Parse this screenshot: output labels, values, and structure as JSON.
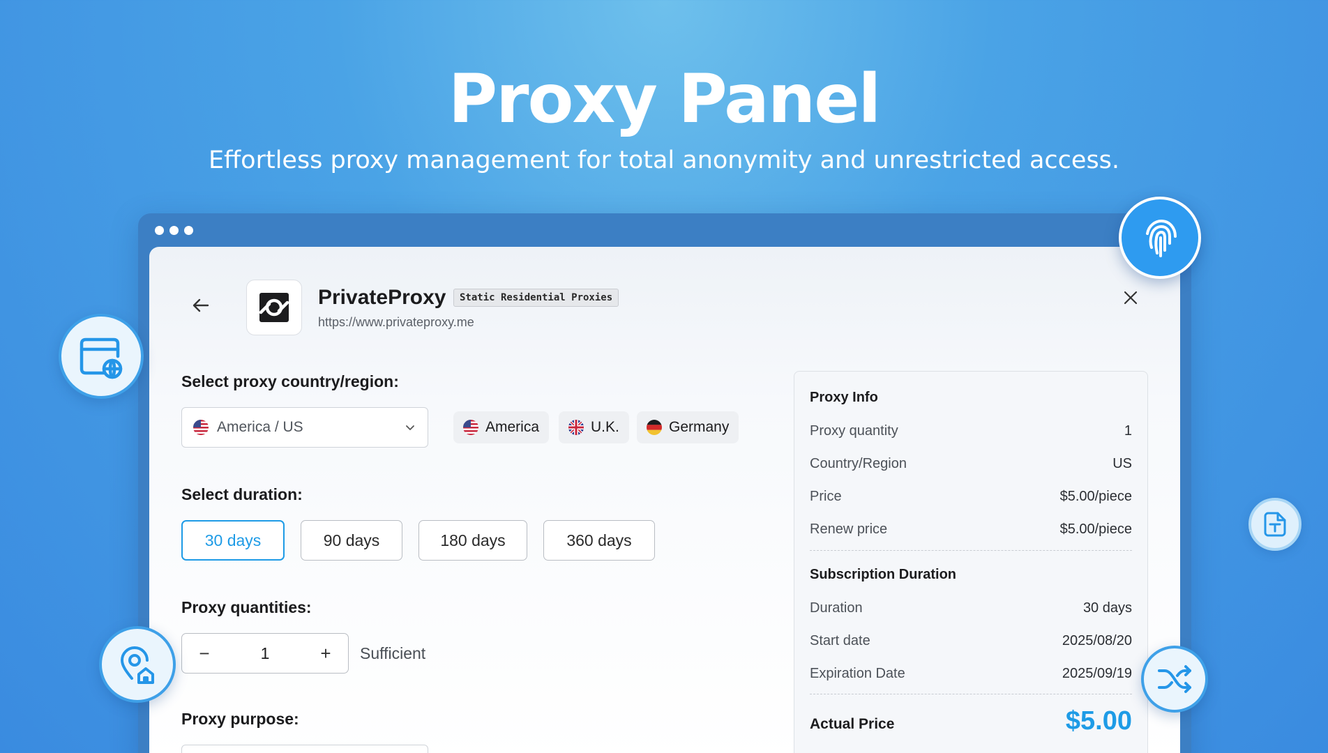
{
  "hero": {
    "title": "Proxy Panel",
    "subtitle": "Effortless proxy management for total anonymity and unrestricted access."
  },
  "app": {
    "name": "PrivateProxy",
    "badge": "Static Residential Proxies",
    "url": "https://www.privateproxy.me"
  },
  "form": {
    "country_label": "Select proxy country/region:",
    "country_selected": "America / US",
    "quick_countries": [
      "America",
      "U.K.",
      "Germany"
    ],
    "duration_label": "Select duration:",
    "durations": [
      "30 days",
      "90 days",
      "180 days",
      "360 days"
    ],
    "duration_selected": "30 days",
    "quantity_label": "Proxy quantities:",
    "quantity_value": "1",
    "quantity_minus": "−",
    "quantity_plus": "+",
    "stock_status": "Sufficient",
    "purpose_label": "Proxy purpose:"
  },
  "info": {
    "title": "Proxy Info",
    "rows": [
      {
        "key": "Proxy quantity",
        "value": "1"
      },
      {
        "key": "Country/Region",
        "value": "US"
      },
      {
        "key": "Price",
        "value": "$5.00/piece"
      },
      {
        "key": "Renew price",
        "value": "$5.00/piece"
      }
    ],
    "subscription_title": "Subscription Duration",
    "subscription_rows": [
      {
        "key": "Duration",
        "value": "30 days"
      },
      {
        "key": "Start date",
        "value": "2025/08/20"
      },
      {
        "key": "Expiration Date",
        "value": "2025/09/19"
      }
    ],
    "actual_price_label": "Actual Price",
    "actual_price_value": "$5.00"
  },
  "colors": {
    "accent": "#1e9be6",
    "background": "#4aa3e6",
    "window_frame": "#3c7fc4"
  },
  "icons": [
    "arrow-left-icon",
    "privateproxy-logo-icon",
    "close-icon",
    "chevron-down-icon",
    "fingerprint-icon",
    "browser-globe-icon",
    "location-home-icon",
    "document-text-icon",
    "shuffle-icon",
    "us-flag-icon",
    "uk-flag-icon",
    "germany-flag-icon"
  ]
}
